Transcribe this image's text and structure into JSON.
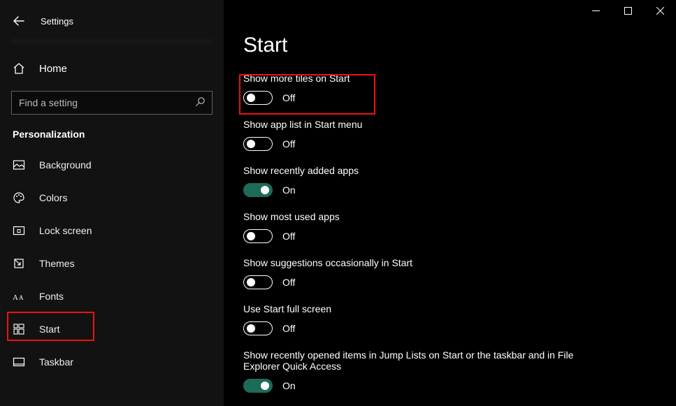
{
  "window": {
    "title": "Settings"
  },
  "sidebar": {
    "home": "Home",
    "search_placeholder": "Find a setting",
    "category": "Personalization",
    "items": [
      {
        "label": "Background"
      },
      {
        "label": "Colors"
      },
      {
        "label": "Lock screen"
      },
      {
        "label": "Themes"
      },
      {
        "label": "Fonts"
      },
      {
        "label": "Start"
      },
      {
        "label": "Taskbar"
      }
    ]
  },
  "main": {
    "title": "Start",
    "on_text": "On",
    "off_text": "Off",
    "settings": [
      {
        "label": "Show more tiles on Start",
        "state": "off"
      },
      {
        "label": "Show app list in Start menu",
        "state": "off"
      },
      {
        "label": "Show recently added apps",
        "state": "on"
      },
      {
        "label": "Show most used apps",
        "state": "off"
      },
      {
        "label": "Show suggestions occasionally in Start",
        "state": "off"
      },
      {
        "label": "Use Start full screen",
        "state": "off"
      },
      {
        "label": "Show recently opened items in Jump Lists on Start or the taskbar and in File Explorer Quick Access",
        "state": "on"
      }
    ]
  }
}
